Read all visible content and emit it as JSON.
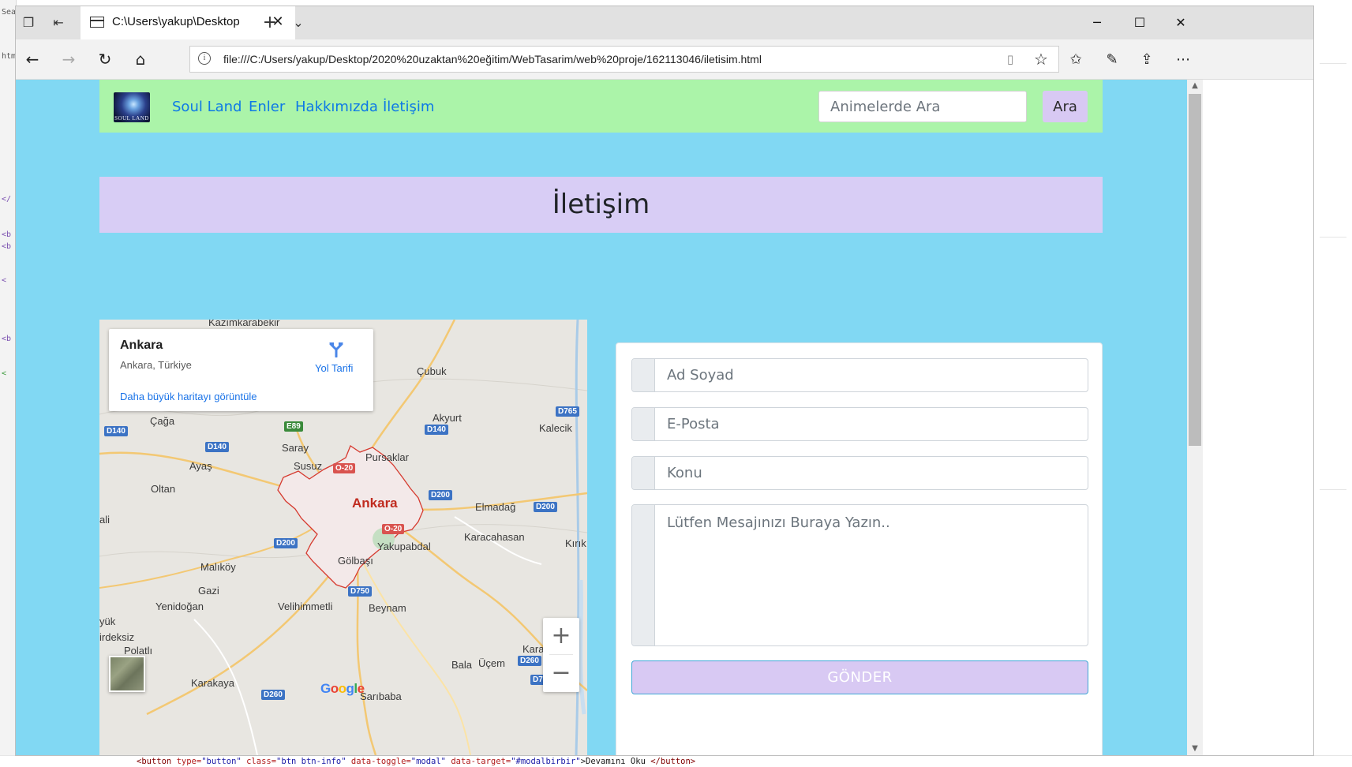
{
  "browser": {
    "tab_title": "C:\\Users\\yakup\\Desktop",
    "new_tab_glyph": "+",
    "tab_list_glyph": "⌄",
    "url": "file:///C:/Users/yakup/Desktop/2020%20uzaktan%20eğitim/WebTasarim/web%20proje/162113046/iletisim.html"
  },
  "background_editor": {
    "left_fragments": [
      "Sea",
      "htm",
      "</",
      "<b",
      "<b",
      "<",
      "<b",
      "<"
    ],
    "bottom_code": {
      "tag_open": "<button",
      "attr1": " type=",
      "val1": "\"button\"",
      "attr2": " class=",
      "val2": "\"btn btn-info\"",
      "attr3": " data-toggle=",
      "val3": "\"modal\"",
      "attr4": " data-target=",
      "val4": "\"#modalbirbir\"",
      "text": ">Devamını Oku ",
      "tag_close": "</button>"
    }
  },
  "site": {
    "logo_text": "SOUL LAND",
    "nav": [
      "Soul Land",
      "Enler",
      "Hakkımızda",
      "İletişim"
    ],
    "search_placeholder": "Animelerde Ara",
    "search_button": "Ara",
    "page_heading": "İletişim"
  },
  "map": {
    "place_title": "Ankara",
    "place_subtitle": "Ankara, Türkiye",
    "directions_label": "Yol Tarifi",
    "larger_map_link": "Daha büyük haritayı görüntüle",
    "zoom_in": "+",
    "zoom_out": "−",
    "city_label": "Ankara",
    "places": [
      "Kazımkarabekir",
      "Çubuk",
      "Akyurt",
      "Kalecik",
      "Çağa",
      "Saray",
      "Susuz",
      "Pursaklar",
      "Ayaş",
      "Oltan",
      "Elmadağ",
      "Kırık",
      "Karacahasan",
      "Yakupabdal",
      "Gölbaşı",
      "Malıköy",
      "Gazi",
      "Yenidoğan",
      "Velihimmetli",
      "Beynam",
      "Polatlı",
      "Bala",
      "Üçem",
      "Karakaya",
      "Kara",
      "ali",
      "yük",
      "irdeksiz",
      "Sarıbaba"
    ],
    "road_shields": [
      "D765",
      "D140",
      "D140",
      "D140",
      "E89",
      "O-20",
      "D200",
      "D200",
      "D200",
      "O-20",
      "D750",
      "D260",
      "D260",
      "D7"
    ],
    "google_logo": "Google"
  },
  "form": {
    "name_placeholder": "Ad Soyad",
    "email_placeholder": "E-Posta",
    "subject_placeholder": "Konu",
    "message_placeholder": "Lütfen Mesajınızı Buraya Yazın..",
    "submit_label": "GÖNDER"
  },
  "colors": {
    "page_background": "#81d8f3",
    "navbar_background": "#abf4a9",
    "heading_band": "#d8cdf5",
    "button_lavender": "#d8c9f3",
    "link_blue": "#0d79e6"
  }
}
